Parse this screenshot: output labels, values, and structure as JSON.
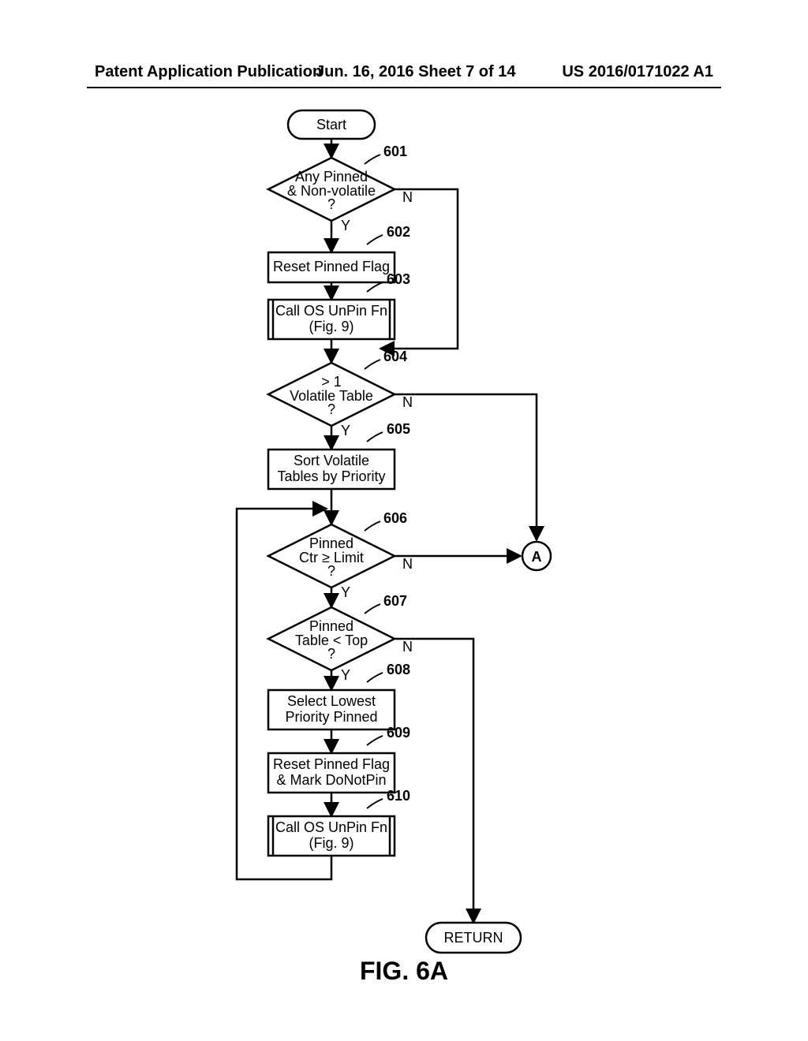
{
  "header": {
    "left": "Patent Application Publication",
    "mid": "Jun. 16, 2016  Sheet 7 of 14",
    "right": "US 2016/0171022 A1"
  },
  "figure_caption": "FIG. 6A",
  "nodes": {
    "start": "Start",
    "d601_l1": "Any Pinned",
    "d601_l2": "& Non-volatile",
    "d601_l3": "?",
    "p602": "Reset Pinned Flag",
    "p603_l1": "Call OS UnPin Fn",
    "p603_l2": "(Fig. 9)",
    "d604_l1": "> 1",
    "d604_l2": "Volatile Table",
    "d604_l3": "?",
    "p605_l1": "Sort Volatile",
    "p605_l2": "Tables by Priority",
    "d606_l1": "Pinned",
    "d606_l2": "Ctr ≥ Limit",
    "d606_l3": "?",
    "d607_l1": "Pinned",
    "d607_l2": "Table < Top",
    "d607_l3": "?",
    "p608_l1": "Select Lowest",
    "p608_l2": "Priority Pinned",
    "p609_l1": "Reset Pinned Flag",
    "p609_l2": "& Mark DoNotPin",
    "p610_l1": "Call OS UnPin Fn",
    "p610_l2": "(Fig. 9)",
    "return": "RETURN",
    "connA": "A"
  },
  "refs": {
    "r601": "601",
    "r602": "602",
    "r603": "603",
    "r604": "604",
    "r605": "605",
    "r606": "606",
    "r607": "607",
    "r608": "608",
    "r609": "609",
    "r610": "610"
  },
  "yn": {
    "Y": "Y",
    "N": "N"
  }
}
